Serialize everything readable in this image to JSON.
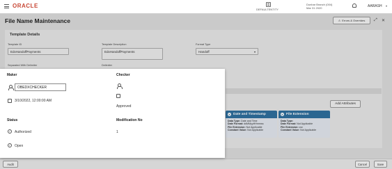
{
  "header": {
    "logo": "ORACLE",
    "entity": "DEFAULTENTITY",
    "branch_line1": "Dunbar Branch  (004)",
    "branch_line2": "Mar 31 2020",
    "user": "AARASH"
  },
  "page": {
    "title": "File Name Maintenance",
    "errors_button": "Errors & Overrides"
  },
  "template_details": {
    "section_title": "Template Details",
    "template_id_label": "Template ID",
    "template_id_value": "EdxHandoffPayments",
    "template_description_label": "Template Description",
    "template_description_value": "EdxHandoffPayments",
    "format_type_label": "Format Type",
    "format_type_value": "Handoff",
    "separated_label": "Separated With Delimiter",
    "delimiter_label": "Delimiter"
  },
  "attributes": {
    "add_button": "Add Attributes",
    "cards": [
      {
        "title": "Date and Timestamp",
        "lines": [
          {
            "k": "Data Type:",
            "v": " Date and Time"
          },
          {
            "k": "Date Format:",
            "v": " ddMMyyHHmmss"
          },
          {
            "k": "File Extension:",
            "v": " Not Applicable"
          },
          {
            "k": "Constant Value:",
            "v": " Not Applicable"
          }
        ]
      },
      {
        "title": "File Extension",
        "lines": [
          {
            "k": "Data Type:",
            "v": ""
          },
          {
            "k": "Date Format:",
            "v": " Not Applicable"
          },
          {
            "k": "File Extension:",
            "v": " csv"
          },
          {
            "k": "Constant Value:",
            "v": " Not Applicable"
          }
        ]
      }
    ]
  },
  "footer": {
    "audit": "Audit",
    "cancel": "Cancel",
    "save": "Save"
  },
  "audit_modal": {
    "maker_label": "Maker",
    "checker_label": "Checker",
    "maker_value": "OBEDXCHECKER",
    "maker_date": "3/10/2022, 12:00:00 AM",
    "checker_status": "Approved",
    "status_label": "Status",
    "mod_no_label": "Modification No",
    "status_value": "Authorized",
    "mod_no_value": "1",
    "record_status": "Open"
  }
}
